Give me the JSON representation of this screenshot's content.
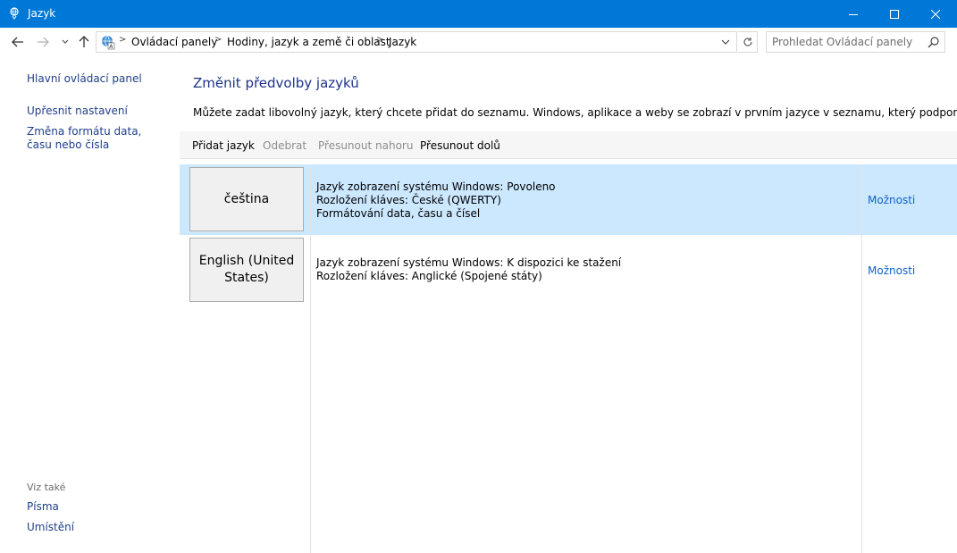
{
  "window": {
    "title": "Jazyk"
  },
  "address": {
    "crumbs": [
      "Ovládací panely",
      "Hodiny, jazyk a země či oblast",
      "Jazyk"
    ]
  },
  "search": {
    "placeholder": "Prohledat Ovládací panely"
  },
  "sidebar": {
    "links": [
      {
        "label": "Hlavní ovládací panel"
      },
      {
        "label": "Upřesnit nastavení"
      },
      {
        "label": "Změna formátu data, času nebo čísla"
      }
    ],
    "see_also_label": "Viz také",
    "see_also": [
      {
        "label": "Písma"
      },
      {
        "label": "Umístění"
      }
    ]
  },
  "main": {
    "heading": "Změnit předvolby jazyků",
    "description": "Můžete zadat libovolný jazyk, který chcete přidat do seznamu. Windows, aplikace a weby se zobrazí v prvním jazyce v seznamu, který podporují."
  },
  "toolbar": {
    "add": "Přidat jazyk",
    "remove": "Odebrat",
    "move_up": "Přesunout nahoru",
    "move_down": "Přesunout dolů"
  },
  "languages": [
    {
      "name": "čeština",
      "details": [
        "Jazyk zobrazení systému Windows: Povoleno",
        "Rozložení kláves: České (QWERTY)",
        "Formátování data, času a čísel"
      ],
      "options": "Možnosti",
      "selected": true
    },
    {
      "name": "English (United States)",
      "details": [
        "Jazyk zobrazení systému Windows: K dispozici ke stažení",
        "Rozložení kláves: Anglické (Spojené státy)"
      ],
      "options": "Možnosti",
      "selected": false
    }
  ],
  "colors": {
    "titlebar": "#0078d7",
    "selection": "#cce8ff",
    "link": "#1062c8",
    "heading": "#1e3287"
  }
}
